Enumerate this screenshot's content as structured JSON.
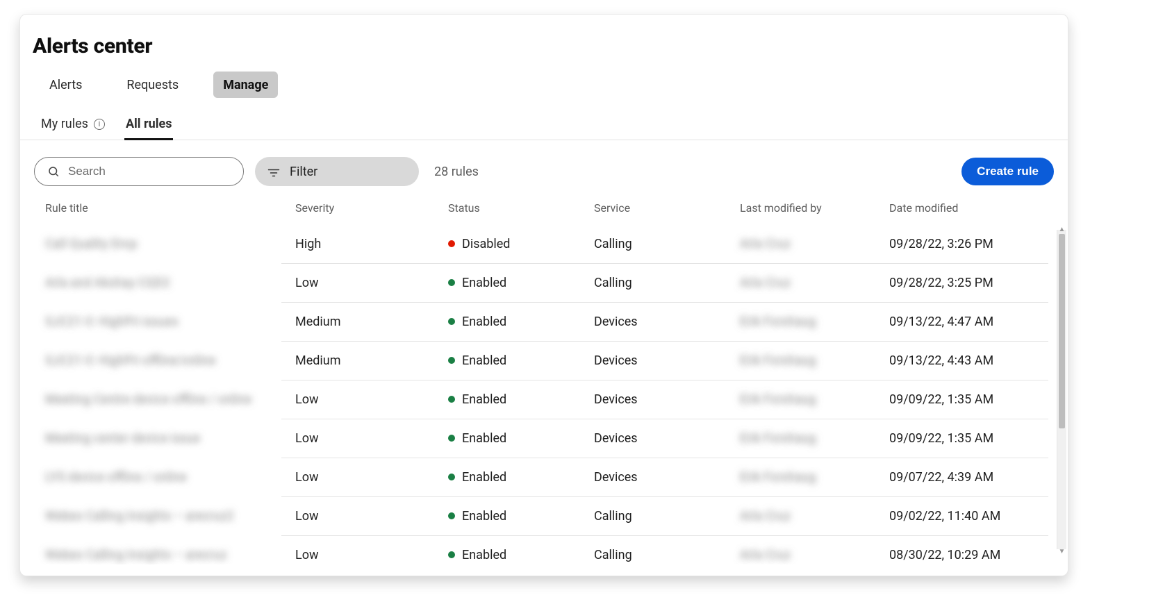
{
  "page": {
    "title": "Alerts center"
  },
  "top_tabs": {
    "items": [
      {
        "label": "Alerts",
        "active": false
      },
      {
        "label": "Requests",
        "active": false
      },
      {
        "label": "Manage",
        "active": true
      }
    ]
  },
  "sub_tabs": {
    "items": [
      {
        "label": "My rules",
        "info": true,
        "active": false
      },
      {
        "label": "All rules",
        "info": false,
        "active": true
      }
    ]
  },
  "toolbar": {
    "search_placeholder": "Search",
    "filter_label": "Filter",
    "rules_count_label": "28 rules",
    "create_label": "Create rule"
  },
  "table": {
    "columns": {
      "rule_title": "Rule title",
      "severity": "Severity",
      "status": "Status",
      "service": "Service",
      "last_modified_by": "Last modified by",
      "date_modified": "Date modified"
    },
    "rows": [
      {
        "title": "Call Quality Drop",
        "severity": "High",
        "status": "Disabled",
        "status_color": "red",
        "service": "Calling",
        "modified_by": "Arla Cruz",
        "date": "09/28/22, 3:26 PM"
      },
      {
        "title": "Arla and Akshay CQD2",
        "severity": "Low",
        "status": "Enabled",
        "status_color": "green",
        "service": "Calling",
        "modified_by": "Arla Cruz",
        "date": "09/28/22, 3:25 PM"
      },
      {
        "title": "SJC21-3: HighPri issues",
        "severity": "Medium",
        "status": "Enabled",
        "status_color": "green",
        "service": "Devices",
        "modified_by": "Erik Forshaug",
        "date": "09/13/22, 4:47 AM"
      },
      {
        "title": "SJC21-3: HighPri offline/online",
        "severity": "Medium",
        "status": "Enabled",
        "status_color": "green",
        "service": "Devices",
        "modified_by": "Erik Forshaug",
        "date": "09/13/22, 4:43 AM"
      },
      {
        "title": "Meeting Centre device offline / online",
        "severity": "Low",
        "status": "Enabled",
        "status_color": "green",
        "service": "Devices",
        "modified_by": "Erik Forshaug",
        "date": "09/09/22, 1:35 AM"
      },
      {
        "title": "Meeting center device issue",
        "severity": "Low",
        "status": "Enabled",
        "status_color": "green",
        "service": "Devices",
        "modified_by": "Erik Forshaug",
        "date": "09/09/22, 1:35 AM"
      },
      {
        "title": "LYS device offline / online",
        "severity": "Low",
        "status": "Enabled",
        "status_color": "green",
        "service": "Devices",
        "modified_by": "Erik Forshaug",
        "date": "09/07/22, 4:39 AM"
      },
      {
        "title": "Webex Calling Insights – arecruz2",
        "severity": "Low",
        "status": "Enabled",
        "status_color": "green",
        "service": "Calling",
        "modified_by": "Arla Cruz",
        "date": "09/02/22, 11:40 AM"
      },
      {
        "title": "Webex Calling Insights – arecruz",
        "severity": "Low",
        "status": "Enabled",
        "status_color": "green",
        "service": "Calling",
        "modified_by": "Arla Cruz",
        "date": "08/30/22, 10:29 AM"
      }
    ]
  },
  "icons": {
    "search": "search-icon",
    "filter": "filter-icon",
    "info": "info-icon"
  },
  "colors": {
    "accent_blue": "#0b5cd9",
    "green": "#1a7f44",
    "red": "#e11900"
  }
}
